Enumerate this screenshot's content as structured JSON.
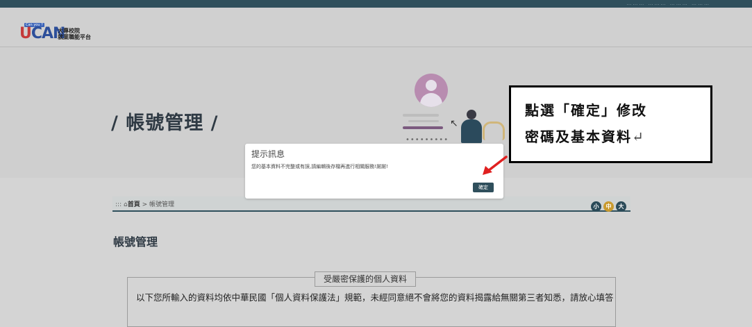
{
  "topbar": {
    "links": "………    ………    ………    ………"
  },
  "logo": {
    "tag": "Can you ?",
    "brand_u": "U",
    "brand_rest": "CAN",
    "line1": "大專校院",
    "line2": "就業職能平台"
  },
  "page": {
    "title": "/ 帳號管理 /"
  },
  "breadcrumb": {
    "prefix": "::: ",
    "home": "首頁",
    "separator": " > ",
    "current": "帳號管理"
  },
  "font_sizes": {
    "small": "小",
    "medium": "中",
    "large": "大"
  },
  "section": {
    "title": "帳號管理"
  },
  "privacy": {
    "legend": "受嚴密保護的個人資料",
    "text": "以下您所輸入的資料均依中華民國「個人資料保護法」規範，未經同意絕不會將您的資料揭露給無關第三者知悉，請放心填答"
  },
  "modal": {
    "title": "提示訊息",
    "message": "您的基本資料不完整或有誤,請編輯後存檔再進行相關服務!謝謝!",
    "confirm_label": "確定"
  },
  "callout": {
    "line1": "點選「確定」修改",
    "line2": "密碼及基本資料",
    "return_mark": "↵"
  },
  "colors": {
    "primary": "#2f4f5c",
    "accent": "#c99a2e",
    "arrow": "#e02020"
  }
}
